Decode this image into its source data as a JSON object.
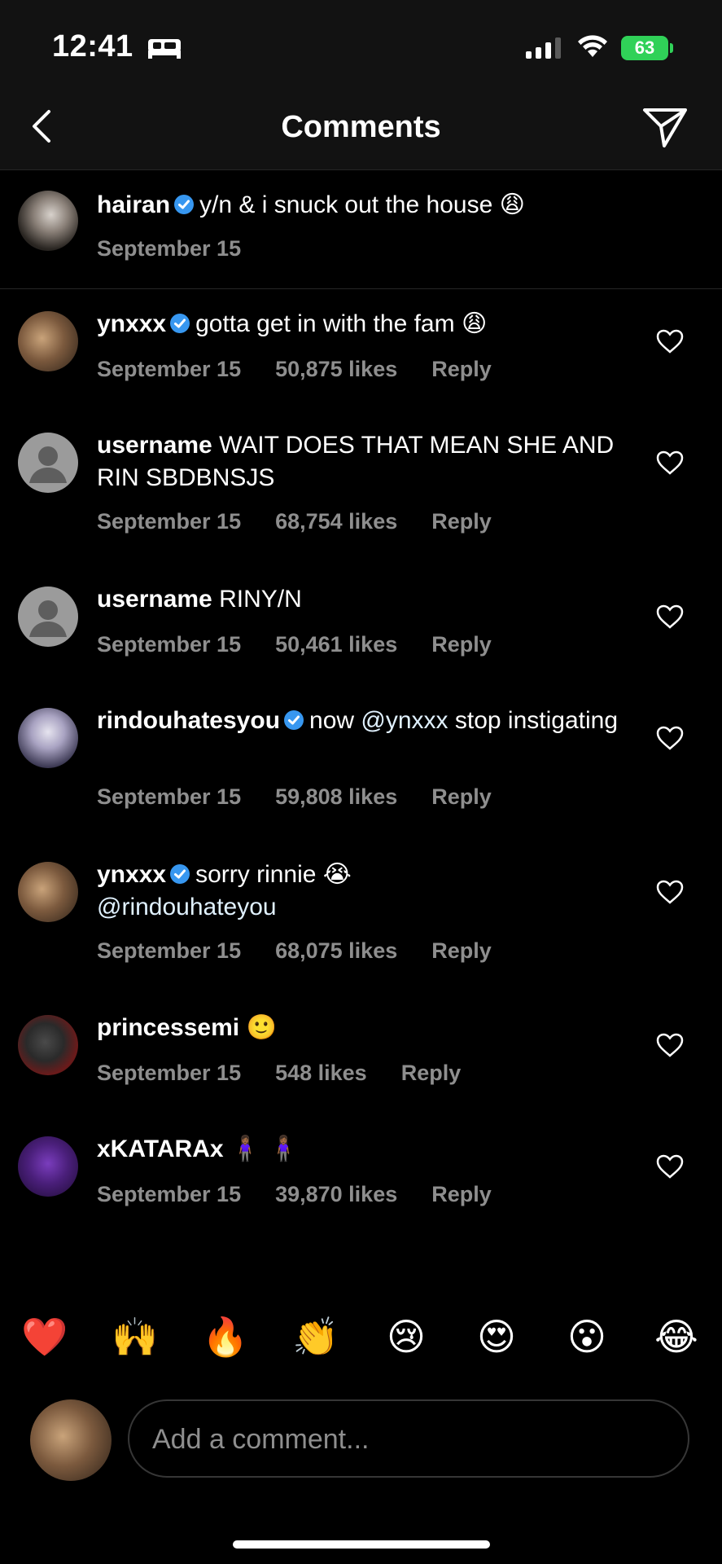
{
  "status_bar": {
    "time": "12:41",
    "battery": "63"
  },
  "header": {
    "title": "Comments"
  },
  "caption": {
    "username": "hairan",
    "text": "y/n & i snuck out the house",
    "emoji": "😩",
    "date": "September 15"
  },
  "comments": [
    {
      "username": "ynxxx",
      "verified": true,
      "text": "gotta get in with the fam",
      "emoji": "😩",
      "date": "September 15",
      "likes": "50,875 likes",
      "reply": "Reply"
    },
    {
      "username": "username",
      "verified": false,
      "text": "WAIT DOES THAT MEAN SHE AND RIN SBDBNSJS",
      "date": "September 15",
      "likes": "68,754 likes",
      "reply": "Reply"
    },
    {
      "username": "username",
      "verified": false,
      "text": "RINY/N",
      "date": "September 15",
      "likes": "50,461 likes",
      "reply": "Reply"
    },
    {
      "username": "rindouhatesyou",
      "verified": true,
      "text": "now",
      "mention": "@ynxxx",
      "text_after": "stop instigating",
      "date": "September 15",
      "likes": "59,808 likes",
      "reply": "Reply"
    },
    {
      "username": "ynxxx",
      "verified": true,
      "text": "sorry rinnie",
      "emoji": "😭",
      "mention": "@rindouhateyou",
      "date": "September 15",
      "likes": "68,075 likes",
      "reply": "Reply"
    },
    {
      "username": "princessemi",
      "verified": false,
      "text": "",
      "emoji": "🙂",
      "date": "September 15",
      "likes": "548 likes",
      "reply": "Reply"
    },
    {
      "username": "xKATARAx",
      "verified": false,
      "text": "",
      "emoji": "🧍🏾‍♀️ 🧍🏾‍♀️",
      "date": "September 15",
      "likes": "39,870 likes",
      "reply": "Reply"
    }
  ],
  "quick_reactions": [
    "❤️",
    "🙌",
    "🔥",
    "👏",
    "😢",
    "😍",
    "😮",
    "😂"
  ],
  "compose": {
    "placeholder": "Add a comment..."
  },
  "colors": {
    "background": "#000000",
    "header": "#121212",
    "meta": "#8e8e8e",
    "verified": "#3797f0",
    "battery": "#30d158"
  }
}
